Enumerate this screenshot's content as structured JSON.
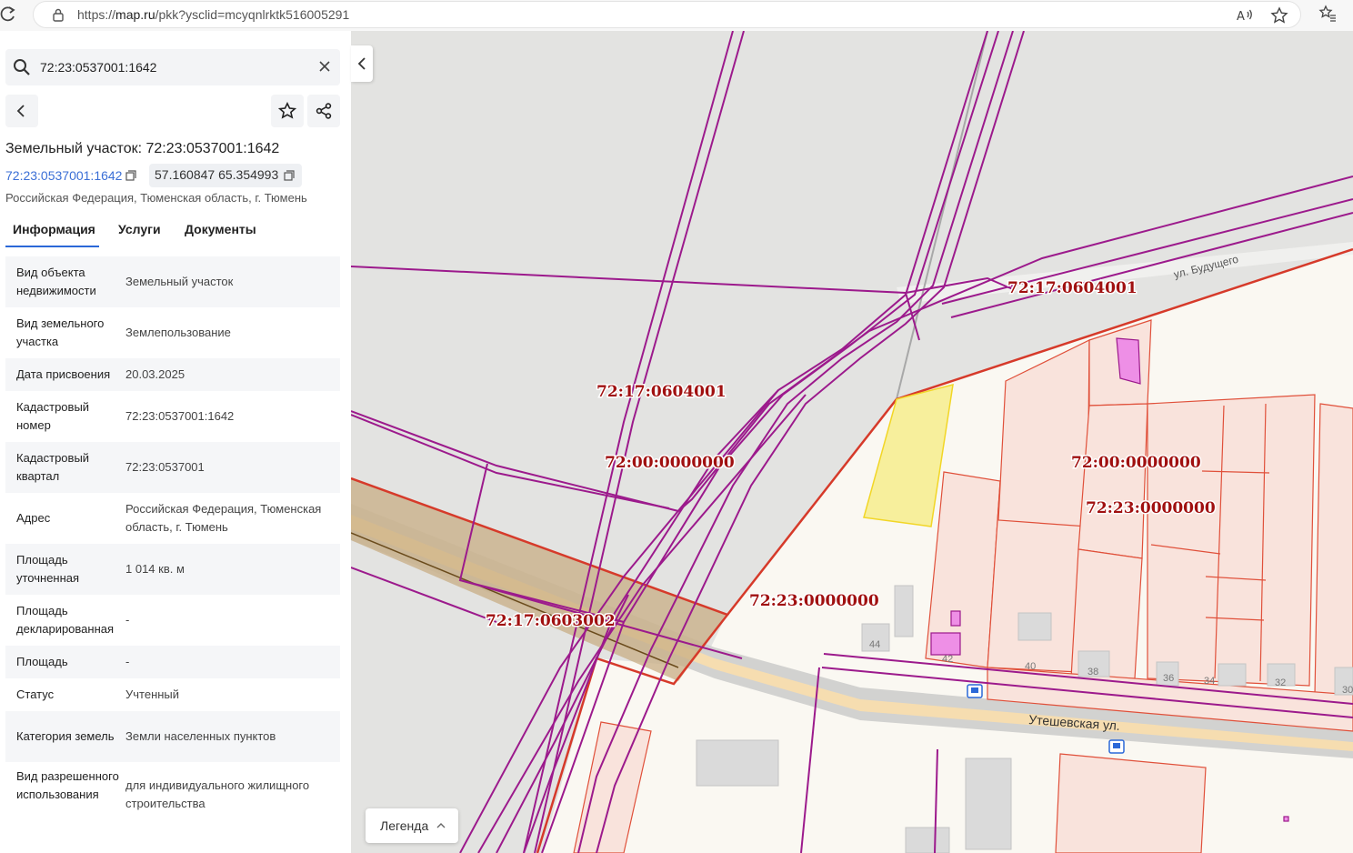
{
  "browser": {
    "url_prefix": "https://",
    "url_host": "map.ru",
    "url_path": "/pkk?ysclid=mcyqnlrktk516005291"
  },
  "search": {
    "value": "72:23:0537001:1642"
  },
  "object": {
    "title": "Земельный участок: 72:23:0537001:1642",
    "cad_link": "72:23:0537001:1642",
    "coords": "57.160847 65.354993",
    "address": "Российская Федерация, Тюменская область, г. Тюмень"
  },
  "tabs": [
    {
      "label": "Информация",
      "active": true
    },
    {
      "label": "Услуги",
      "active": false
    },
    {
      "label": "Документы",
      "active": false
    }
  ],
  "info_rows": [
    {
      "label": "Вид объекта недвижимости",
      "value": "Земельный участок"
    },
    {
      "label": "Вид земельного участка",
      "value": "Землепользование"
    },
    {
      "label": "Дата присвоения",
      "value": "20.03.2025"
    },
    {
      "label": "Кадастровый номер",
      "value": "72:23:0537001:1642"
    },
    {
      "label": "Кадастровый квартал",
      "value": "72:23:0537001"
    },
    {
      "label": "Адрес",
      "value": "Российская Федерация, Тюменская область, г. Тюмень"
    },
    {
      "label": "Площадь уточненная",
      "value": "1 014 кв. м"
    },
    {
      "label": "Площадь декларированная",
      "value": "-"
    },
    {
      "label": "Площадь",
      "value": "-"
    },
    {
      "label": "Статус",
      "value": "Учтенный"
    },
    {
      "label": "Категория земель",
      "value": "Земли населенных пунктов"
    },
    {
      "label": "Вид разрешенного использования",
      "value": "для индивидуального жилищного строительства"
    }
  ],
  "map": {
    "labels": [
      {
        "text": "72:17:0604001",
        "id": "a"
      },
      {
        "text": "72:17:0604001",
        "id": "b"
      },
      {
        "text": "72:00:0000000",
        "id": "c"
      },
      {
        "text": "72:00:0000000",
        "id": "d"
      },
      {
        "text": "72:23:0000000",
        "id": "e"
      },
      {
        "text": "72:23:0000000",
        "id": "f"
      },
      {
        "text": "72:17:0603002",
        "id": "g"
      }
    ],
    "streets": {
      "budushchego": "ул. Будущего",
      "uteshevskaya": "Утешевская ул."
    },
    "house_numbers": [
      "44",
      "42",
      "40",
      "38",
      "36",
      "34",
      "32",
      "30"
    ],
    "legend_label": "Легенда"
  },
  "colors": {
    "accent": "#2b68d8",
    "link": "#3b6fd6",
    "boundary_purple": "#9c1a8c",
    "parcel_red": "#e0503a",
    "selected_parcel": "#f7ef9c",
    "label_red": "#a01010"
  }
}
